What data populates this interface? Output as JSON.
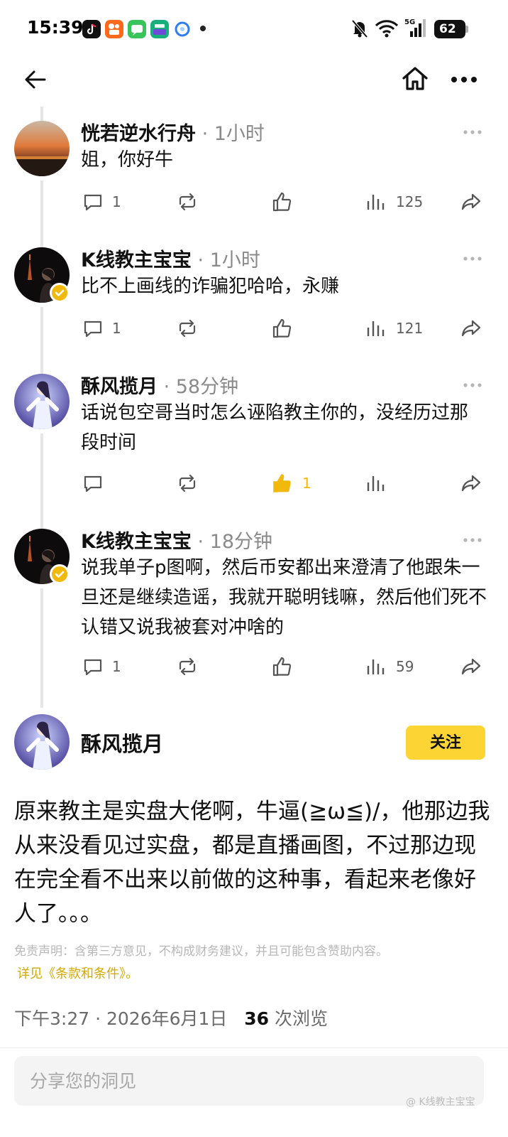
{
  "status_bar": {
    "time": "15:39",
    "network": "5G",
    "battery": "62"
  },
  "comments": [
    {
      "username": "恍若逆水行舟",
      "separator": " · ",
      "time_ago": "1小时",
      "text": "姐，你好牛",
      "reply_count": "1",
      "like_count": "",
      "views": "125",
      "liked": false,
      "verified": false
    },
    {
      "username": "K线教主宝宝",
      "separator": " · ",
      "time_ago": "1小时",
      "text": "比不上画线的诈骗犯哈哈，永赚",
      "reply_count": "1",
      "like_count": "",
      "views": "121",
      "liked": false,
      "verified": true
    },
    {
      "username": "酥风揽月",
      "separator": " · ",
      "time_ago": "58分钟",
      "text": "话说包空哥当时怎么诬陷教主你的，没经历过那段时间",
      "reply_count": "",
      "like_count": "1",
      "views": "",
      "liked": true,
      "verified": false
    },
    {
      "username": "K线教主宝宝",
      "separator": " · ",
      "time_ago": "18分钟",
      "text": "说我单子p图啊，然后币安都出来澄清了他跟朱一旦还是继续造谣，我就开聪明钱嘛，然后他们死不认错又说我被套对冲啥的",
      "reply_count": "1",
      "like_count": "",
      "views": "59",
      "liked": false,
      "verified": true
    }
  ],
  "post": {
    "author": "酥风揽月",
    "follow_label": "关注",
    "text": "原来教主是实盘大佬啊，牛逼(≧ω≦)/，他那边我从来没看见过实盘，都是直播画图，不过那边现在完全看不出来以前做的这种事，看起来老像好人了。。。",
    "disclaimer": "免责声明：含第三方意见，不构成财务建议，并且可能包含赞助内容。",
    "terms_link": "详见《条款和条件》。",
    "posted_at": "下午3:27 · 2026年6月1日",
    "view_count": "36",
    "views_label": "次浏览"
  },
  "reply_box": {
    "placeholder": "分享您的洞见"
  },
  "watermark": "@ K线教主宝宝",
  "colors": {
    "accent": "#fcd535",
    "like_active": "#f0b90b",
    "muted": "#8a8a8a"
  }
}
